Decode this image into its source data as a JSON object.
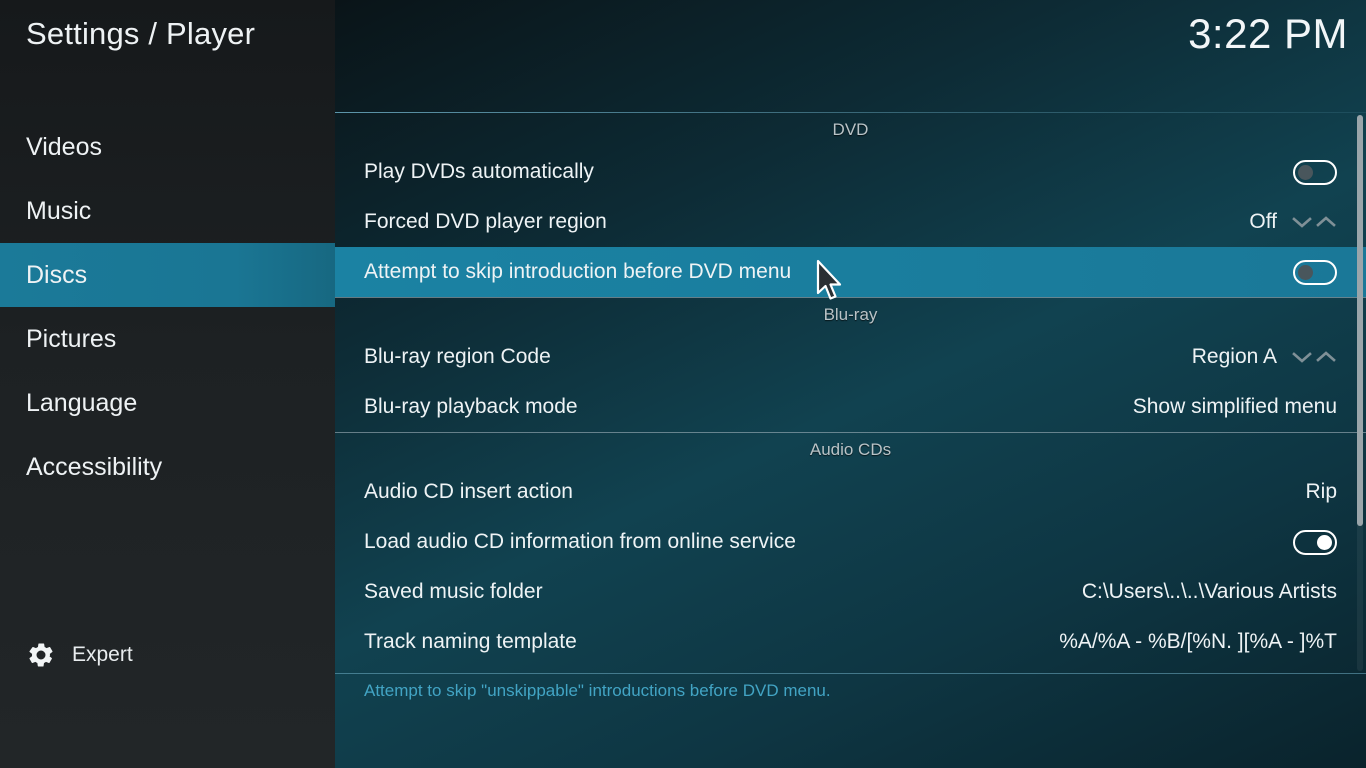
{
  "window": {
    "title": "Settings / Player",
    "clock": "3:22 PM"
  },
  "sidebar": {
    "items": [
      {
        "label": "Videos",
        "selected": false
      },
      {
        "label": "Music",
        "selected": false
      },
      {
        "label": "Discs",
        "selected": true
      },
      {
        "label": "Pictures",
        "selected": false
      },
      {
        "label": "Language",
        "selected": false
      },
      {
        "label": "Accessibility",
        "selected": false
      }
    ],
    "level": {
      "icon": "gear-icon",
      "label": "Expert"
    }
  },
  "sections": [
    {
      "header": "DVD",
      "rows": [
        {
          "label": "Play DVDs automatically",
          "control": "toggle",
          "value": "off"
        },
        {
          "label": "Forced DVD player region",
          "control": "spinner",
          "value": "Off"
        },
        {
          "label": "Attempt to skip introduction before DVD menu",
          "control": "toggle",
          "value": "off",
          "highlight": true
        }
      ]
    },
    {
      "header": "Blu-ray",
      "rows": [
        {
          "label": "Blu-ray region Code",
          "control": "spinner",
          "value": "Region A"
        },
        {
          "label": "Blu-ray playback mode",
          "control": "text",
          "value": "Show simplified menu"
        }
      ]
    },
    {
      "header": "Audio CDs",
      "rows": [
        {
          "label": "Audio CD insert action",
          "control": "text",
          "value": "Rip"
        },
        {
          "label": "Load audio CD information from online service",
          "control": "toggle",
          "value": "on"
        },
        {
          "label": "Saved music folder",
          "control": "text",
          "value": "C:\\Users\\..\\..\\Various Artists"
        },
        {
          "label": "Track naming template",
          "control": "text",
          "value": "%A/%A - %B/[%N. ][%A - ]%T"
        }
      ]
    }
  ],
  "help": {
    "text": "Attempt to skip \"unskippable\" introductions before DVD menu."
  },
  "colors": {
    "accent": "#1b82a3",
    "sidebar_selected": "#1b7a99",
    "help_text": "#42a4c4",
    "section_header_text": "#b9c3c7",
    "scrollbar_thumb": "#9aa5aa"
  },
  "scrollbar": {
    "thumb_ratio": 0.74
  }
}
